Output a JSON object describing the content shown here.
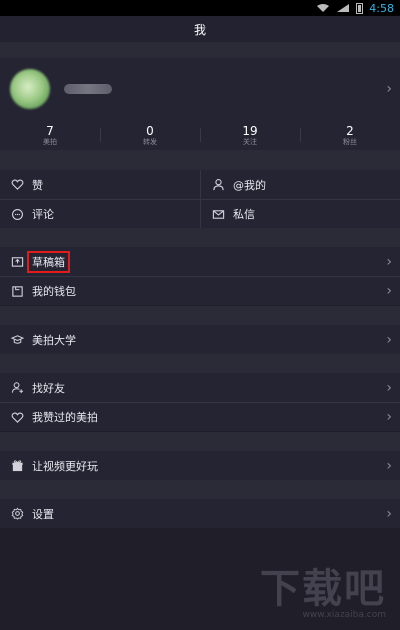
{
  "status_bar": {
    "time": "4:58"
  },
  "header": {
    "title": "我"
  },
  "profile": {
    "username_obscured": true
  },
  "stats": [
    {
      "value": "7",
      "label": "美拍"
    },
    {
      "value": "0",
      "label": "转发"
    },
    {
      "value": "19",
      "label": "关注"
    },
    {
      "value": "2",
      "label": "粉丝"
    }
  ],
  "quick_grid": {
    "like": "赞",
    "mention": "@我的",
    "comment": "评论",
    "message": "私信"
  },
  "menu": {
    "drafts": "草稿箱",
    "wallet": "我的钱包",
    "university": "美拍大学",
    "find_friends": "找好友",
    "liked": "我赞过的美拍",
    "better_video": "让视频更好玩",
    "settings": "设置"
  },
  "watermark": {
    "big": "下载吧",
    "small": "www.xiazaiba.com"
  },
  "colors": {
    "background": "#1f1e29",
    "panel": "#252433",
    "status_time": "#33b5e5",
    "highlight": "#e21b1b"
  }
}
